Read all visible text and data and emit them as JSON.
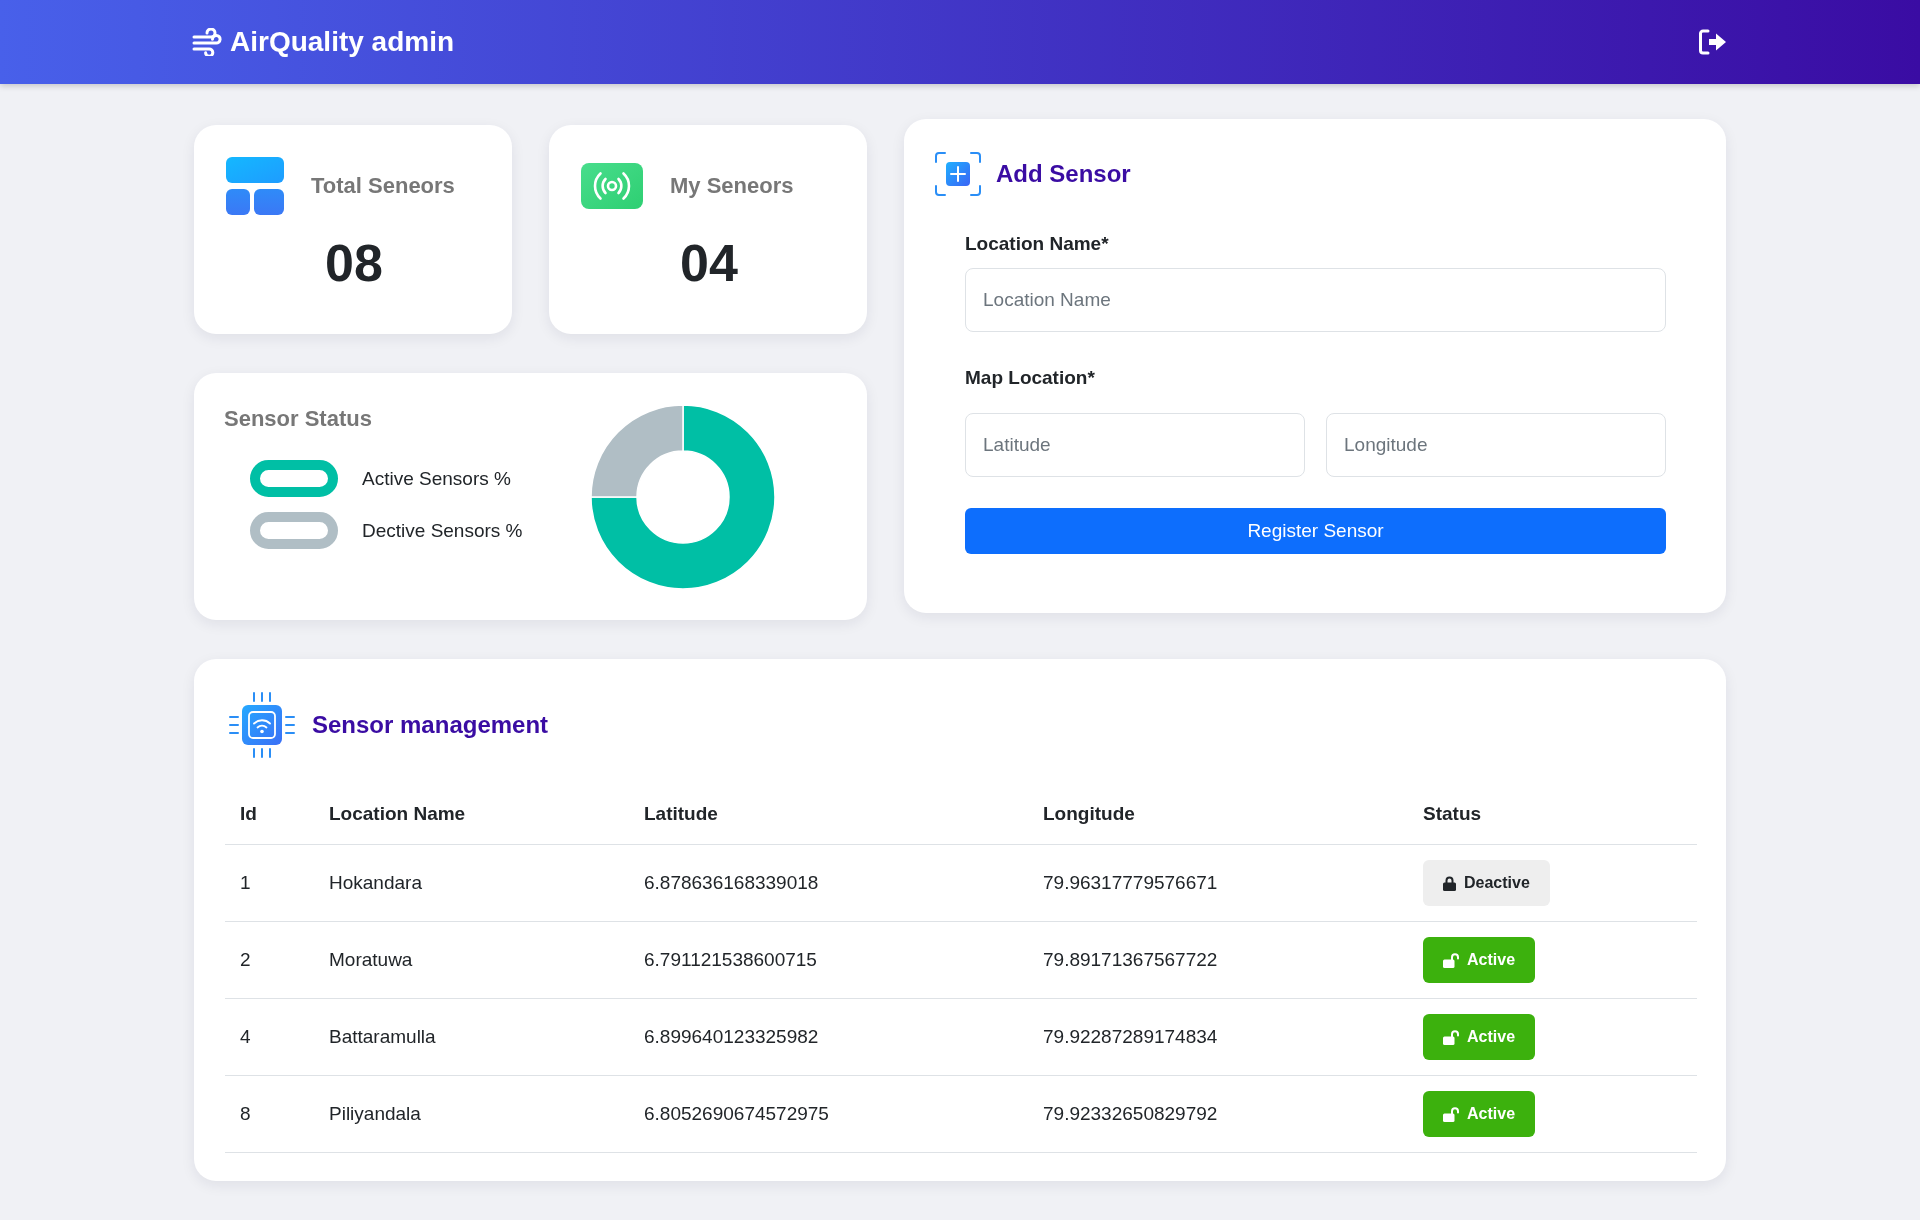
{
  "header": {
    "title": "AirQuality admin"
  },
  "stats": [
    {
      "kind": "total",
      "label": "Total Seneors",
      "value": "08"
    },
    {
      "kind": "mine",
      "label": "My Seneors",
      "value": "04"
    }
  ],
  "sensor_status": {
    "chart_data": {
      "type": "donut",
      "title": "Sensor Status",
      "categories": [
        "Active Sensors %",
        "Dective Sensors %"
      ],
      "values": [
        75,
        25
      ],
      "colors": [
        "#00bfa5",
        "#b0bec5"
      ],
      "legend": "left"
    }
  },
  "add_sensor": {
    "title": "Add Sensor",
    "fields": [
      {
        "label": "Location Name*",
        "inputs": [
          {
            "placeholder": "Location Name"
          }
        ]
      },
      {
        "label": "Map Location*",
        "inputs": [
          {
            "placeholder": "Latitude"
          },
          {
            "placeholder": "Longitude"
          }
        ]
      }
    ],
    "button": "Register Sensor"
  },
  "sensor_management": {
    "title": "Sensor management",
    "table": {
      "columns": [
        "Id",
        "Location Name",
        "Latitude",
        "Longitude",
        "Status"
      ],
      "rows": [
        {
          "cells": [
            "1",
            "Hokandara",
            "6.878636168339018",
            "79.96317779576671"
          ],
          "status": {
            "label": "Deactive",
            "active": false
          }
        },
        {
          "cells": [
            "2",
            "Moratuwa",
            "6.791121538600715",
            "79.89171367567722"
          ],
          "status": {
            "label": "Active",
            "active": true
          }
        },
        {
          "cells": [
            "4",
            "Battaramulla",
            "6.899640123325982",
            "79.92287289174834"
          ],
          "status": {
            "label": "Active",
            "active": true
          }
        },
        {
          "cells": [
            "8",
            "Piliyandala",
            "6.8052690674572975",
            "79.92332650829792"
          ],
          "status": {
            "label": "Active",
            "active": true
          }
        }
      ]
    }
  }
}
